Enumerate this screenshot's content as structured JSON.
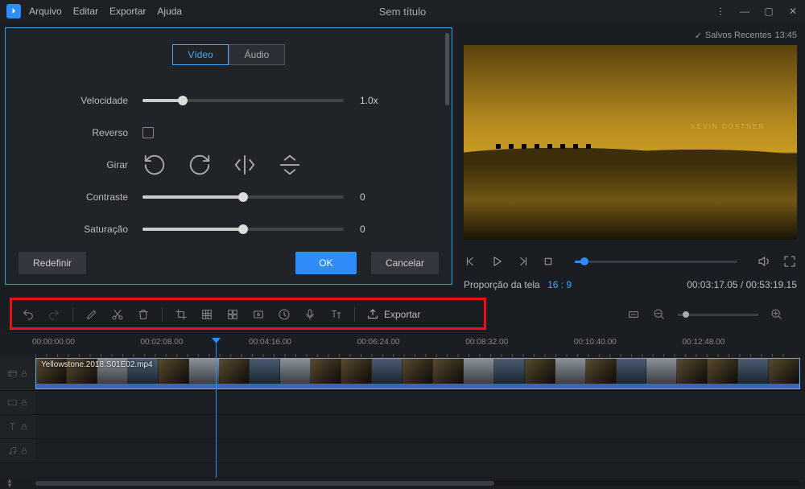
{
  "menu": {
    "arquivo": "Arquivo",
    "editar": "Editar",
    "exportar": "Exportar",
    "ajuda": "Ajuda"
  },
  "title": "Sem título",
  "saved": {
    "prefix": "Salvos Recentes",
    "time": "13:45"
  },
  "settings": {
    "tab_video": "Vídeo",
    "tab_audio": "Áudio",
    "velocidade": {
      "label": "Velocidade",
      "value": "1.0x"
    },
    "reverso": {
      "label": "Reverso"
    },
    "girar": {
      "label": "Girar"
    },
    "contraste": {
      "label": "Contraste",
      "value": "0"
    },
    "saturacao": {
      "label": "Saturação",
      "value": "0"
    },
    "redefinir": "Redefinir",
    "ok": "OK",
    "cancelar": "Cancelar"
  },
  "preview": {
    "credit": "KEVIN COSTNER"
  },
  "transport": {
    "ratio_label": "Proporção da tela",
    "ratio_value": "16 : 9",
    "time": "00:03:17.05 / 00:53:19.15"
  },
  "toolbar": {
    "export": "Exportar"
  },
  "ruler": [
    "00:00:00.00",
    "00:02:08.00",
    "00:04:16.00",
    "00:06:24.00",
    "00:08:32.00",
    "00:10:40.00",
    "00:12:48.00"
  ],
  "clip": {
    "name": "Yellowstone.2018.S01E02.mp4"
  }
}
